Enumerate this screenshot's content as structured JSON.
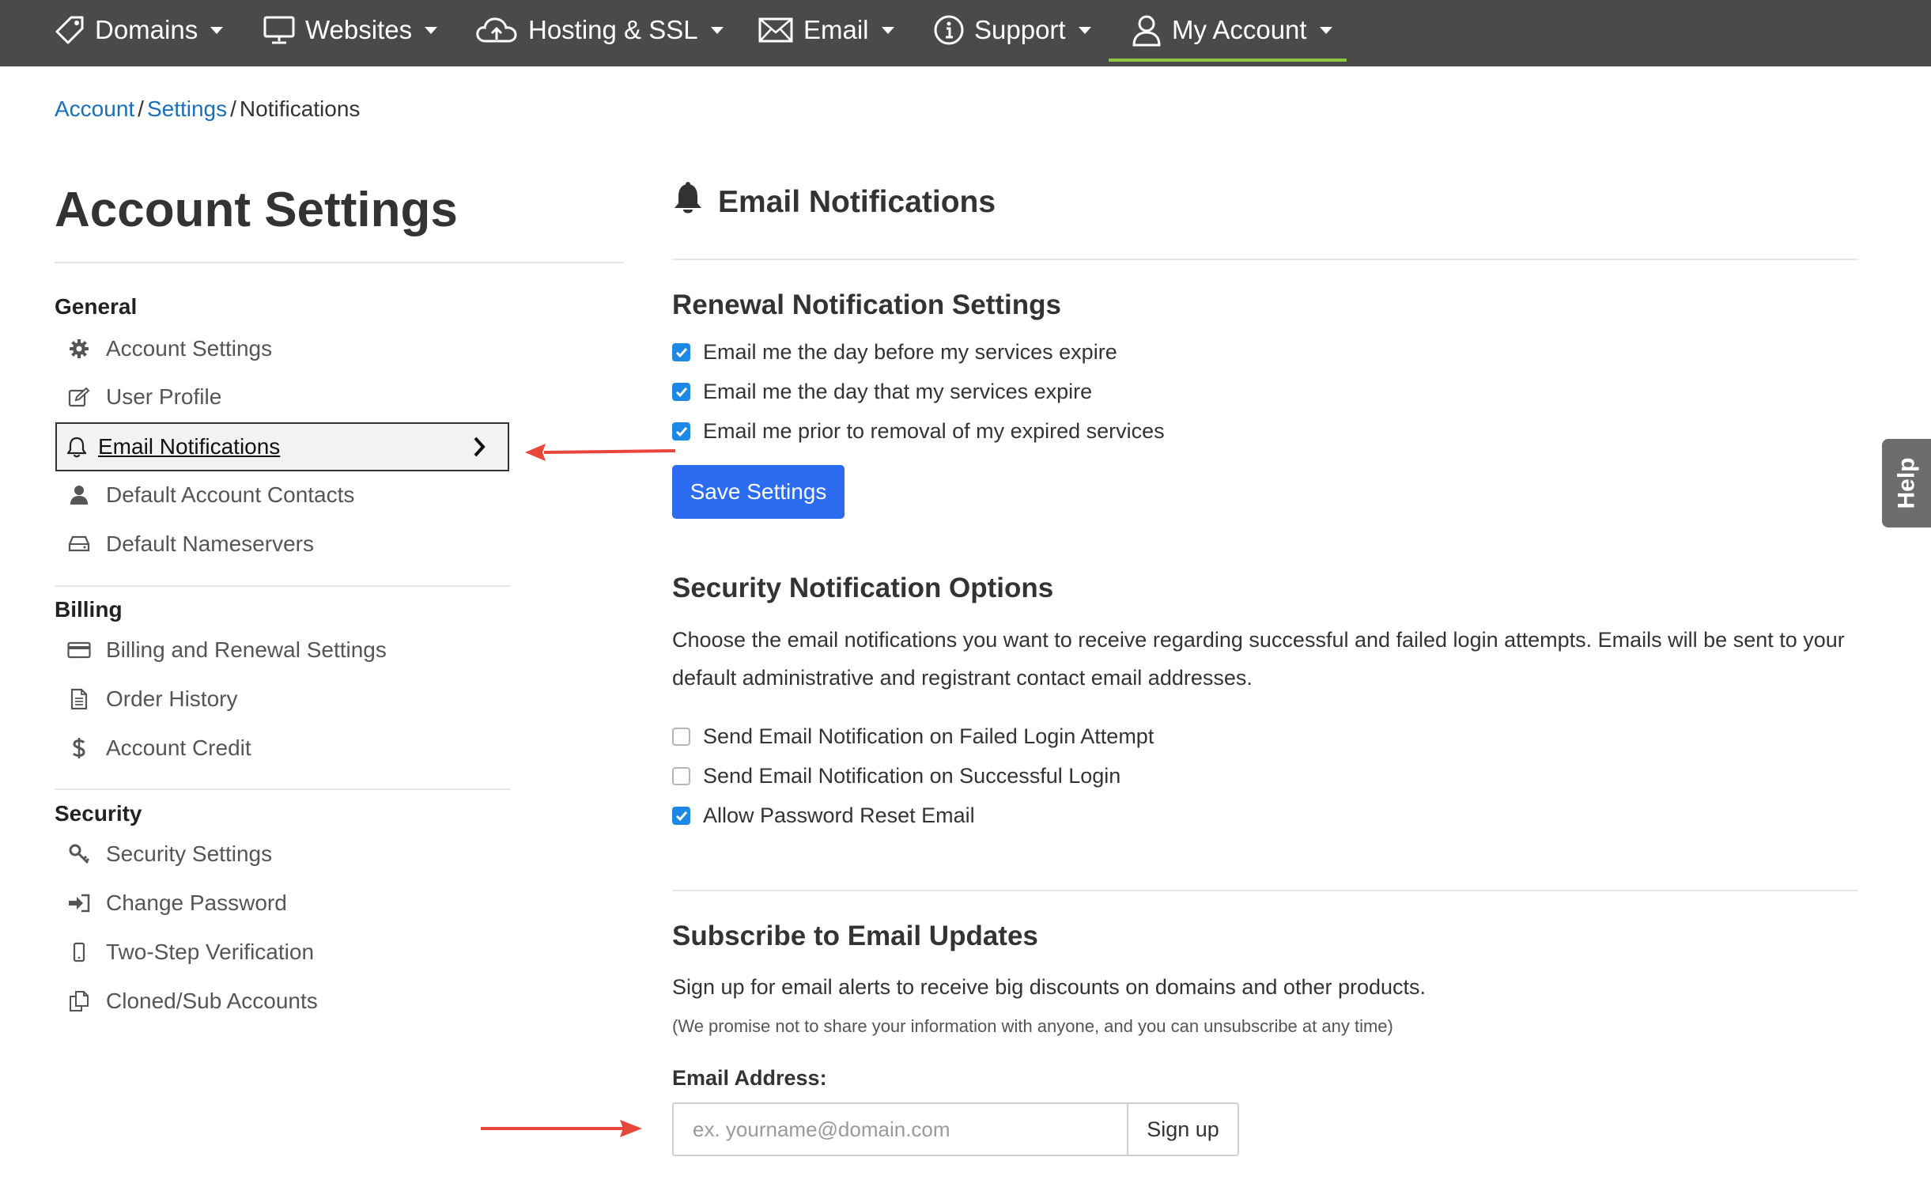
{
  "nav": {
    "items": [
      {
        "label": "Domains",
        "icon": "tag-icon"
      },
      {
        "label": "Websites",
        "icon": "monitor-icon"
      },
      {
        "label": "Hosting & SSL",
        "icon": "cloud-upload-icon"
      },
      {
        "label": "Email",
        "icon": "envelope-icon"
      },
      {
        "label": "Support",
        "icon": "info-circle-icon"
      },
      {
        "label": "My Account",
        "icon": "user-icon",
        "active": true
      }
    ],
    "active_color": "#8dc63f"
  },
  "breadcrumb": {
    "items": [
      "Account",
      "Settings",
      "Notifications"
    ],
    "separator": "/"
  },
  "sidebar": {
    "title": "Account Settings",
    "groups": [
      {
        "label": "General",
        "items": [
          {
            "label": "Account Settings",
            "icon": "gear-icon"
          },
          {
            "label": "User Profile",
            "icon": "edit-icon"
          },
          {
            "label": "Email Notifications",
            "icon": "bell-icon",
            "active": true
          },
          {
            "label": "Default Account Contacts",
            "icon": "person-icon"
          },
          {
            "label": "Default Nameservers",
            "icon": "hard-drive-icon"
          }
        ]
      },
      {
        "label": "Billing",
        "items": [
          {
            "label": "Billing and Renewal Settings",
            "icon": "credit-card-icon"
          },
          {
            "label": "Order History",
            "icon": "document-icon"
          },
          {
            "label": "Account Credit",
            "icon": "dollar-icon"
          }
        ]
      },
      {
        "label": "Security",
        "items": [
          {
            "label": "Security Settings",
            "icon": "key-icon"
          },
          {
            "label": "Change Password",
            "icon": "sign-in-icon"
          },
          {
            "label": "Two-Step Verification",
            "icon": "mobile-icon"
          },
          {
            "label": "Cloned/Sub Accounts",
            "icon": "copy-icon"
          }
        ]
      }
    ]
  },
  "main": {
    "title": "Email Notifications",
    "renewal": {
      "title": "Renewal Notification Settings",
      "options": [
        {
          "label": "Email me the day before my services expire",
          "checked": true
        },
        {
          "label": "Email me the day that my services expire",
          "checked": true
        },
        {
          "label": "Email me prior to removal of my expired services",
          "checked": true
        }
      ],
      "save_label": "Save Settings"
    },
    "security": {
      "title": "Security Notification Options",
      "description": "Choose the email notifications you want to receive regarding successful and failed login attempts. Emails will be sent to your default administrative and registrant contact email addresses.",
      "options": [
        {
          "label": "Send Email Notification on Failed Login Attempt",
          "checked": false
        },
        {
          "label": "Send Email Notification on Successful Login",
          "checked": false
        },
        {
          "label": "Allow Password Reset Email",
          "checked": true
        }
      ]
    },
    "subscribe": {
      "title": "Subscribe to Email Updates",
      "description": "Sign up for email alerts to receive big discounts on domains and other products.",
      "note": "(We promise not to share your information with anyone, and you can unsubscribe at any time)",
      "email_label": "Email Address:",
      "email_placeholder": "ex. yourname@domain.com",
      "email_value": "",
      "signup_label": "Sign up"
    }
  },
  "help_tab": {
    "label": "Help"
  },
  "colors": {
    "nav_bg": "#4a4a4b",
    "link": "#1a6fb7",
    "primary_button": "#2b6cf1",
    "checkbox_checked": "#1e88e5",
    "annotation_arrow": "#e8453c"
  }
}
